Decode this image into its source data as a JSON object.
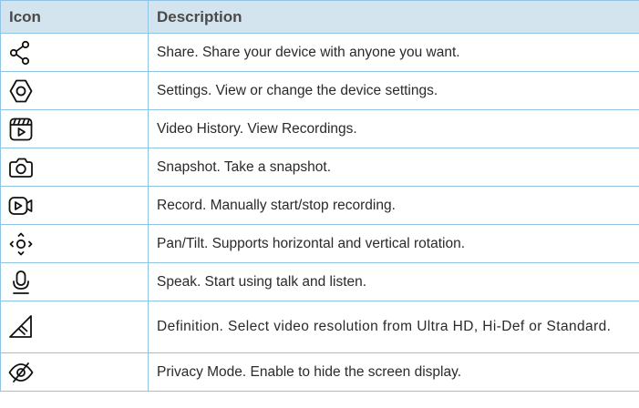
{
  "table": {
    "headers": {
      "icon": "Icon",
      "description": "Description"
    },
    "rows": [
      {
        "icon": "share-icon",
        "description": "Share. Share your device with anyone you want."
      },
      {
        "icon": "settings-icon",
        "description": "Settings. View or change the device settings."
      },
      {
        "icon": "video-history-icon",
        "description": "Video History. View Recordings."
      },
      {
        "icon": "snapshot-icon",
        "description": "Snapshot. Take a snapshot."
      },
      {
        "icon": "record-icon",
        "description": "Record. Manually start/stop recording."
      },
      {
        "icon": "pan-tilt-icon",
        "description": "Pan/Tilt. Supports horizontal and vertical rotation."
      },
      {
        "icon": "speak-icon",
        "description": "Speak. Start using talk and listen."
      },
      {
        "icon": "definition-icon",
        "description": "Definition. Select video resolution from Ultra HD, Hi-Def or Standard."
      },
      {
        "icon": "privacy-mode-icon",
        "description": "Privacy Mode. Enable to hide the screen display."
      }
    ]
  },
  "colors": {
    "border": "#8fc4e6",
    "header_bg": "#d3e4ef",
    "header_text": "#4a4a4a",
    "text": "#2a2a2a"
  }
}
